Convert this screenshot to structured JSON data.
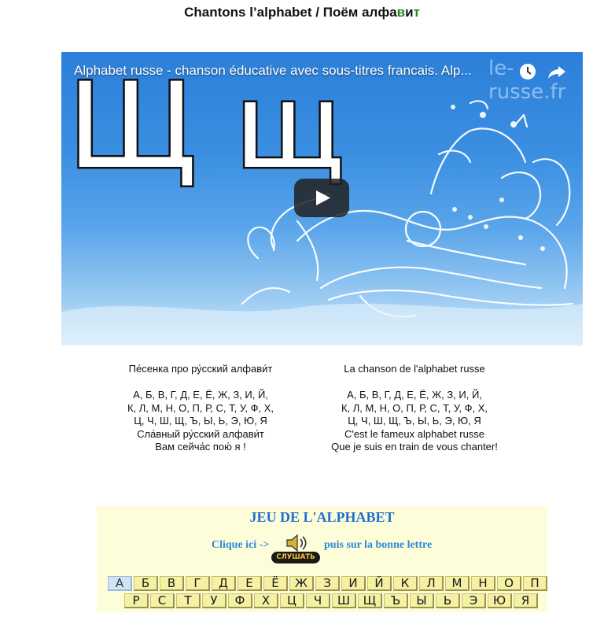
{
  "header": {
    "title_fr": "Chantons l’alphabet / ",
    "title_ru_pre": "Поём алфа",
    "title_ru_green1": "в",
    "title_ru_mid": "и",
    "title_ru_green2": "т"
  },
  "video": {
    "title": "Alphabet russe - chanson éducative avec sous-titres francais. Alp...",
    "watermark": "le-russe.fr",
    "big_letters": "Щ щ"
  },
  "lyrics": {
    "ru": {
      "heading": "Пе́сенка про ру́сский алфави́т",
      "lines": [
        "А, Б, В, Г, Д, Е, Ё, Ж, З, И, Й,",
        "К, Л, М, Н, О, П, Р, С, Т, У, Ф, Х,",
        "Ц, Ч, Ш, Щ, Ъ, Ы, Ь, Э, Ю, Я",
        "Сла́вный ру́сский алфави́т",
        "Вам сейча́с пою́ я !"
      ]
    },
    "fr": {
      "heading": "La chanson de l'alphabet russe",
      "lines": [
        "А, Б, В, Г, Д, Е, Ё, Ж, З, И, Й,",
        "К, Л, М, Н, О, П, Р, С, Т, У, Ф, Х,",
        "Ц, Ч, Ш, Щ, Ъ, Ы, Ь, Э, Ю, Я",
        "C'est le fameux alphabet russe",
        "Que je suis en train de vous chanter!"
      ]
    }
  },
  "game": {
    "title": "JEU DE L'ALPHABET",
    "clique": "Clique ici ->",
    "puis": "puis sur la bonne lettre",
    "listen_label": "СЛУШАТЬ",
    "row1": [
      "А",
      "Б",
      "В",
      "Г",
      "Д",
      "Е",
      "Ё",
      "Ж",
      "З",
      "И",
      "Й",
      "К",
      "Л",
      "М",
      "Н",
      "О",
      "П"
    ],
    "row2": [
      "Р",
      "С",
      "Т",
      "У",
      "Ф",
      "Х",
      "Ц",
      "Ч",
      "Ш",
      "Щ",
      "Ъ",
      "Ы",
      "Ь",
      "Э",
      "Ю",
      "Я"
    ],
    "selected_letter": "А"
  },
  "colors": {
    "title_green": "#1f8a1f",
    "game_blue": "#1f6fd0",
    "game_bg": "#fefdda",
    "letter_bg": "#f4f0a4",
    "letter_selected_bg": "#d0e3f7"
  }
}
